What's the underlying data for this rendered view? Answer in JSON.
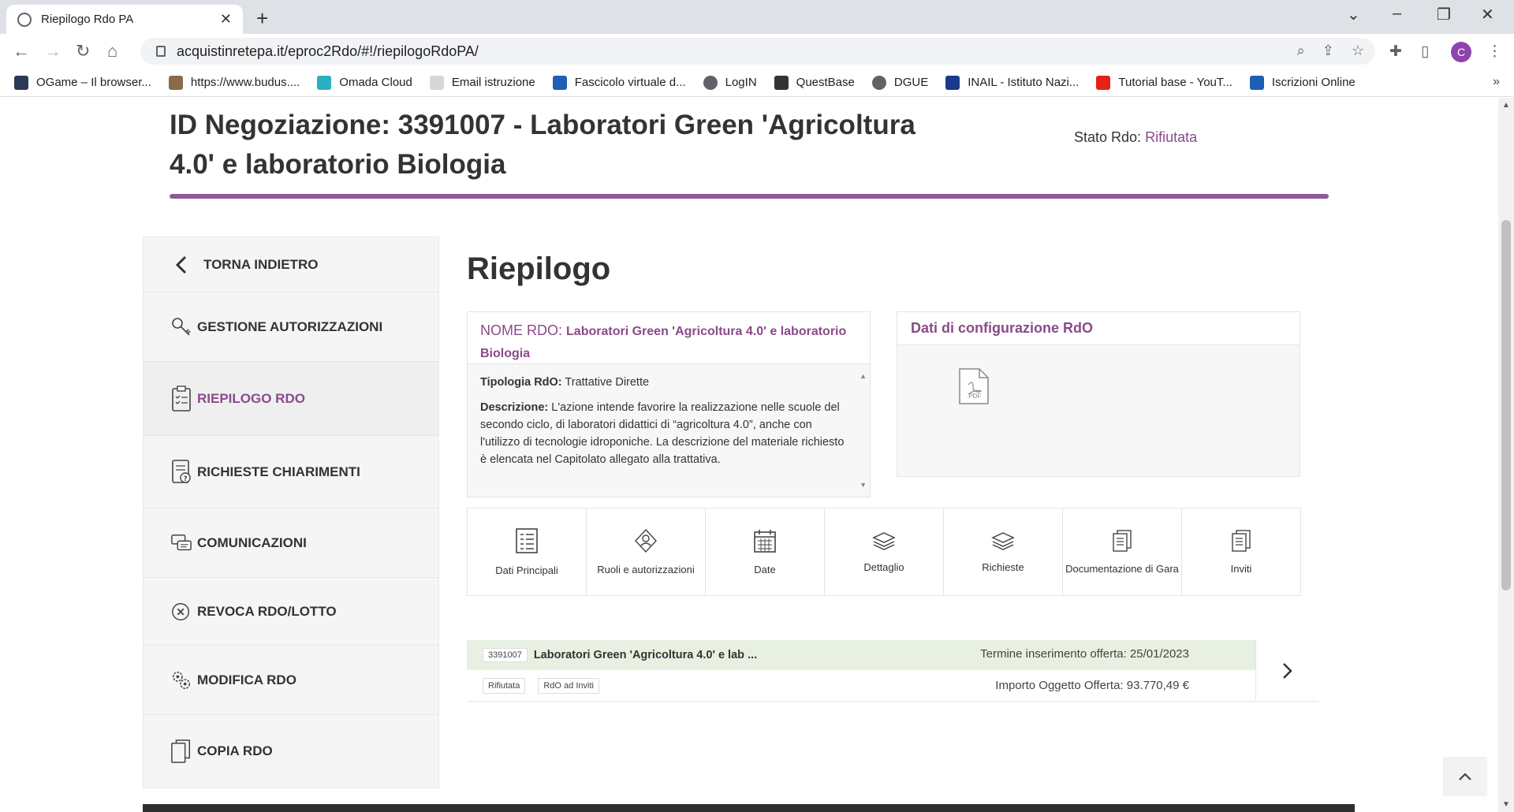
{
  "browser": {
    "tab_title": "Riepilogo Rdo PA",
    "url": "acquistinretepa.it/eproc2Rdo/#!/riepilogoRdoPA/",
    "avatar_letter": "C",
    "bookmarks": [
      {
        "label": "OGame – Il browser...",
        "icon": "ogame-icon",
        "color": "#2b3a55"
      },
      {
        "label": "https://www.budus....",
        "icon": "budus-icon",
        "color": "#8a6a4a"
      },
      {
        "label": "Omada Cloud",
        "icon": "wifi-icon",
        "color": "#2ab0c0"
      },
      {
        "label": "Email istruzione",
        "icon": "email-icon",
        "color": "#d6d6d6"
      },
      {
        "label": "Fascicolo virtuale d...",
        "icon": "fascicolo-icon",
        "color": "#1e5fb4"
      },
      {
        "label": "LogIN",
        "icon": "globe-icon",
        "color": "#5f6368"
      },
      {
        "label": "QuestBase",
        "icon": "questbase-icon",
        "color": "#333333"
      },
      {
        "label": "DGUE",
        "icon": "globe-icon",
        "color": "#5f6368"
      },
      {
        "label": "INAIL - Istituto Nazi...",
        "icon": "inail-icon",
        "color": "#1a3a8a"
      },
      {
        "label": "Tutorial base - YouT...",
        "icon": "youtube-icon",
        "color": "#e62117"
      },
      {
        "label": "Iscrizioni Online",
        "icon": "iscrizioni-icon",
        "color": "#1e5fb4"
      }
    ]
  },
  "header": {
    "title": "ID Negoziazione: 3391007 - Laboratori Green 'Agricoltura 4.0' e laboratorio Biologia",
    "stato_label": "Stato Rdo:",
    "stato_value": "Rifiutata",
    "accent": "#8d5a97"
  },
  "sidebar": {
    "items": [
      {
        "label": "TORNA INDIETRO",
        "icon": "chevron-left-icon"
      },
      {
        "label": "GESTIONE AUTORIZZAZIONI",
        "icon": "keys-icon"
      },
      {
        "label": "RIEPILOGO RDO",
        "icon": "clipboard-icon"
      },
      {
        "label": "RICHIESTE CHIARIMENTI",
        "icon": "question-document-icon"
      },
      {
        "label": "COMUNICAZIONI",
        "icon": "chat-icon"
      },
      {
        "label": "REVOCA RDO/LOTTO",
        "icon": "revoke-icon"
      },
      {
        "label": "MODIFICA RDO",
        "icon": "gears-icon"
      },
      {
        "label": "COPIA RDO",
        "icon": "copy-icon"
      }
    ]
  },
  "main": {
    "heading": "Riepilogo",
    "nome": {
      "label": "NOME RDO:",
      "value": "Laboratori Green 'Agricoltura 4.0' e laboratorio Biologia",
      "tipologia_label": "Tipologia RdO:",
      "tipologia_value": "Trattative Dirette",
      "descrizione_label": "Descrizione:",
      "descrizione_value": "L'azione intende favorire la realizzazione nelle scuole del secondo ciclo, di laboratori didattici di “agricoltura 4.0”, anche con l'utilizzo di tecnologie idroponiche. La descrizione del materiale richiesto è elencata nel Capitolato allegato alla trattativa."
    },
    "config": {
      "title": "Dati di configurazione RdO",
      "pdf_label": ".PDF"
    },
    "tiles": [
      {
        "label": "Dati Principali",
        "icon": "list-document-icon"
      },
      {
        "label": "Ruoli e autorizzazioni",
        "icon": "roles-icon"
      },
      {
        "label": "Date",
        "icon": "calendar-icon"
      },
      {
        "label": "Dettaglio",
        "icon": "layers-icon"
      },
      {
        "label": "Richieste",
        "icon": "layers-icon"
      },
      {
        "label": "Documentazione di Gara",
        "icon": "documents-icon"
      },
      {
        "label": "Inviti",
        "icon": "documents-icon"
      }
    ],
    "rdo": {
      "id": "3391007",
      "name": "Laboratori Green 'Agricoltura 4.0' e lab ...",
      "termine": "Termine inserimento offerta: 25/01/2023",
      "badges": [
        "Rifiutata",
        "RdO ad Inviti"
      ],
      "importo": "Importo Oggetto Offerta: 93.770,49 €"
    }
  }
}
